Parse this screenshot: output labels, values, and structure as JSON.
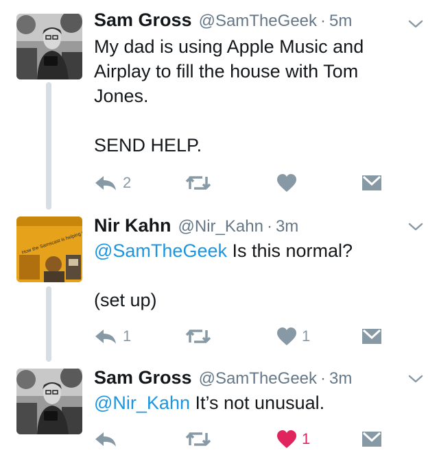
{
  "tweets": [
    {
      "name": "Sam Gross",
      "handle": "@SamTheGeek",
      "time": "5m",
      "mention": "",
      "text": "My dad is using Apple Music and Airplay to fill the house with Tom Jones.\n\nSEND HELP.",
      "reply_count": "2",
      "like_count": "",
      "liked": false
    },
    {
      "name": "Nir Kahn",
      "handle": "@Nir_Kahn",
      "time": "3m",
      "mention": "@SamTheGeek",
      "text": " Is this normal?\n\n(set up)",
      "reply_count": "1",
      "like_count": "1",
      "liked": false,
      "avatar_text": "How the Samscast is helping to form your next car"
    },
    {
      "name": "Sam Gross",
      "handle": "@SamTheGeek",
      "time": "3m",
      "mention": "@Nir_Kahn",
      "text": " It’s not unusual.",
      "reply_count": "",
      "like_count": "1",
      "liked": true
    }
  ],
  "separator": "·",
  "colors": {
    "text": "#14171a",
    "secondary": "#657786",
    "icon": "#8899a6",
    "link": "#1b95e0",
    "like": "#e0245e",
    "thread_line": "#d6dde3"
  },
  "icons": [
    "reply-icon",
    "retweet-icon",
    "heart-icon",
    "direct-message-icon",
    "chevron-down-icon"
  ]
}
